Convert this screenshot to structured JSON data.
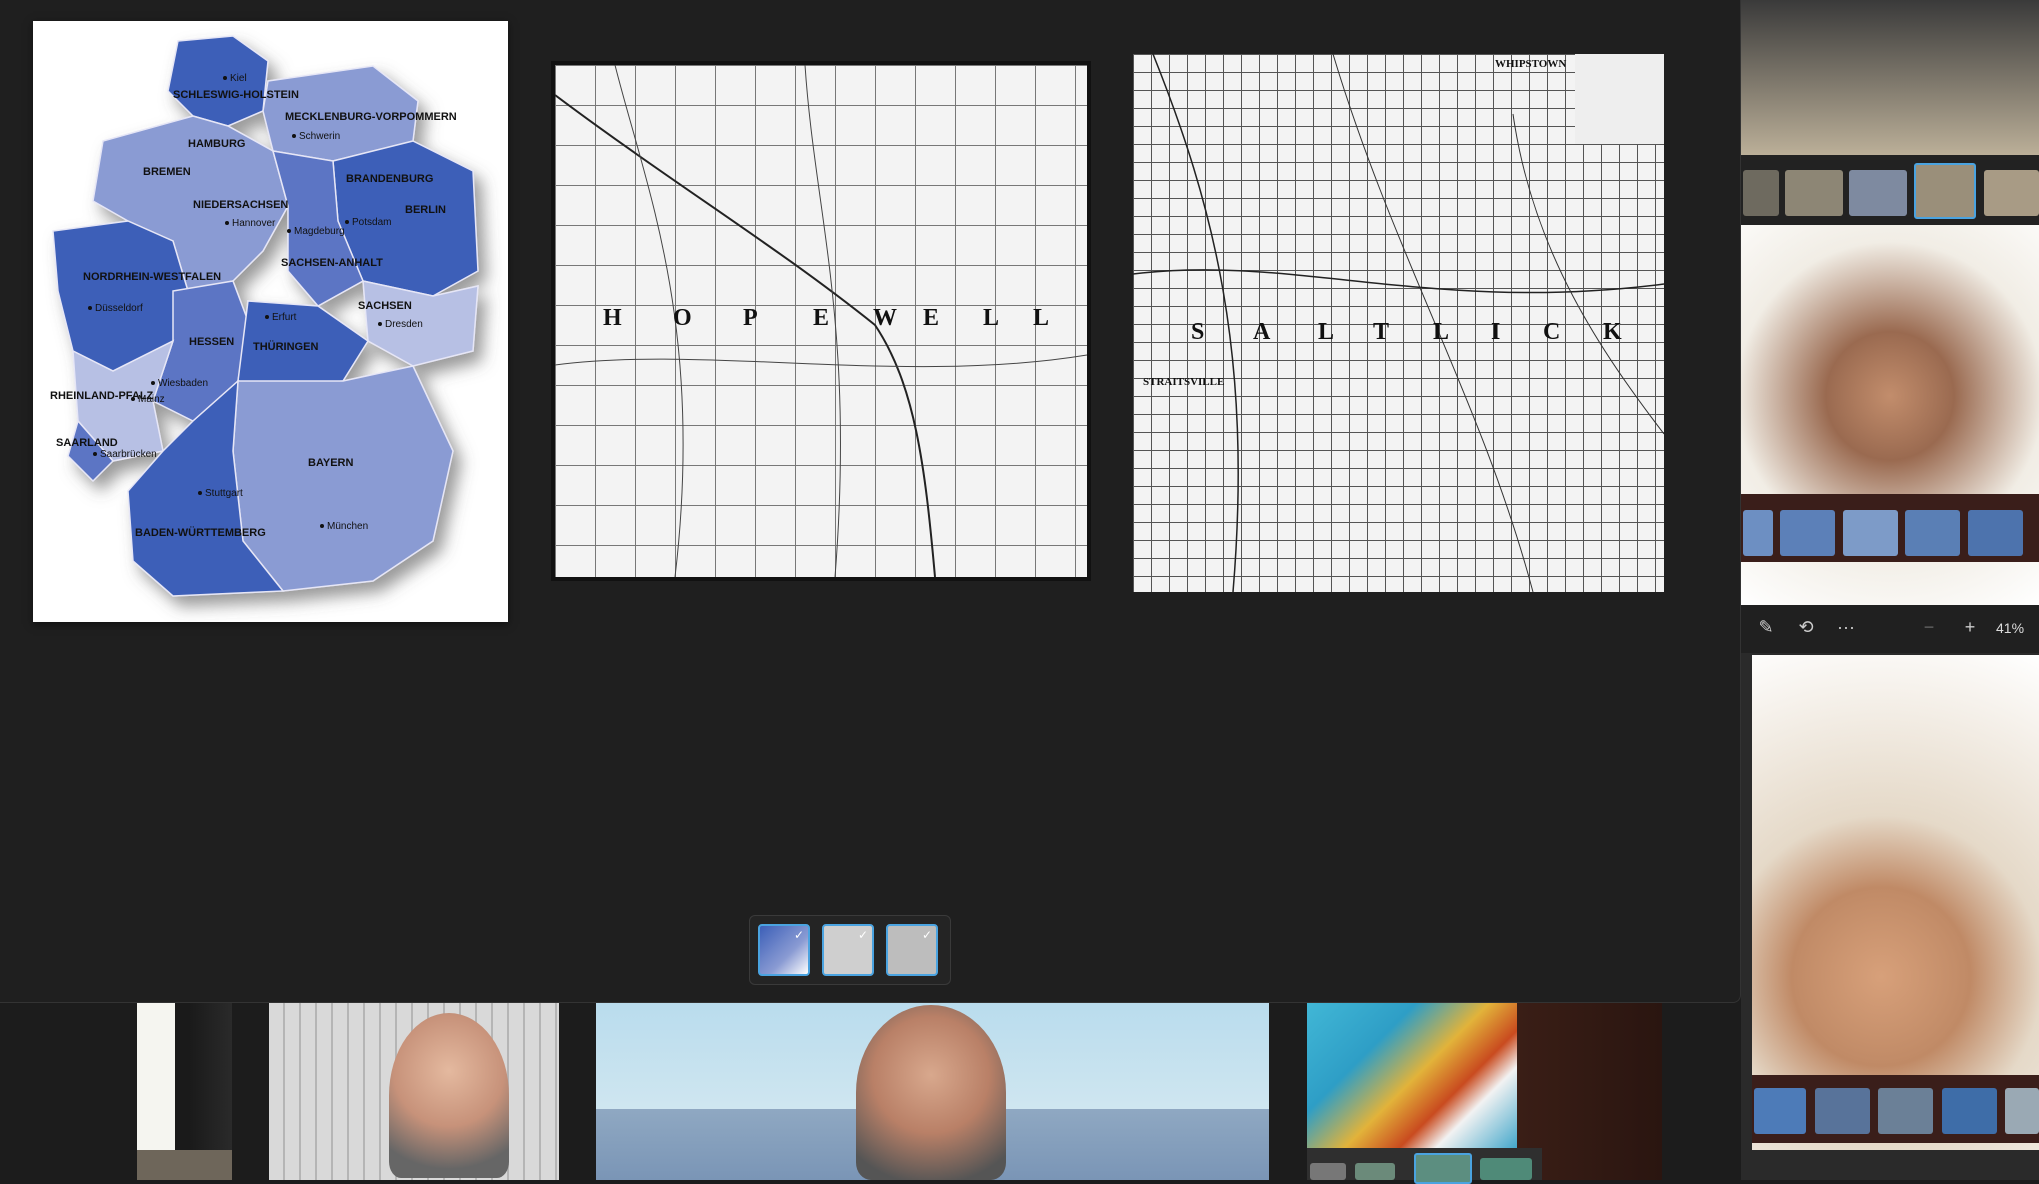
{
  "germany_map": {
    "states": [
      {
        "name": "SCHLESWIG-HOLSTEIN"
      },
      {
        "name": "MECKLENBURG-VORPOMMERN"
      },
      {
        "name": "HAMBURG"
      },
      {
        "name": "BREMEN"
      },
      {
        "name": "NIEDERSACHSEN"
      },
      {
        "name": "BRANDENBURG"
      },
      {
        "name": "BERLIN"
      },
      {
        "name": "SACHSEN-ANHALT"
      },
      {
        "name": "NORDRHEIN-WESTFALEN"
      },
      {
        "name": "SACHSEN"
      },
      {
        "name": "HESSEN"
      },
      {
        "name": "THÜRINGEN"
      },
      {
        "name": "RHEINLAND-PFALZ"
      },
      {
        "name": "SAARLAND"
      },
      {
        "name": "BAYERN"
      },
      {
        "name": "BADEN-WÜRTTEMBERG"
      }
    ],
    "cities": [
      "Kiel",
      "Schwerin",
      "Hannover",
      "Magdeburg",
      "Potsdam",
      "Düsseldorf",
      "Erfurt",
      "Dresden",
      "Wiesbaden",
      "Mainz",
      "Saarbrücken",
      "Stuttgart",
      "München"
    ]
  },
  "map2": {
    "township_letters": [
      "H",
      "O",
      "P",
      "E",
      "W",
      "E",
      "L",
      "L"
    ]
  },
  "map3": {
    "township_letters": [
      "S",
      "A",
      "L",
      "T",
      "L",
      "I",
      "C",
      "K"
    ],
    "town": "STRAITSVILLE",
    "corner": "WHIPSTOWN"
  },
  "tray": {
    "thumbs": [
      "germany-map",
      "hopewell-map",
      "saltlick-map"
    ],
    "check": "✓"
  },
  "right_toolbar": {
    "zoom": "41%",
    "more": "···"
  },
  "colors": {
    "state_dark": "#3c5fb8",
    "state_mid": "#5b74c4",
    "state_light": "#8a9bd3",
    "state_pale": "#b7c0e4",
    "accent": "#4aa3e0"
  }
}
